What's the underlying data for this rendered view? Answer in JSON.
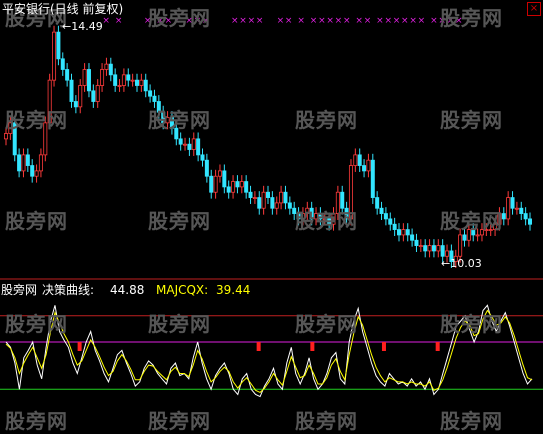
{
  "window": {
    "title": "平安银行(日线 前复权)",
    "close_glyph": "×"
  },
  "watermark": "股旁网",
  "price_panel": {
    "high_label": "14.49",
    "low_label": "10.03",
    "marker_glyph": "×",
    "colors": {
      "up": "#ff3b3b",
      "down": "#33e5ff",
      "marker": "#e020e0"
    }
  },
  "indicator_panel": {
    "name": "股旁网",
    "line1_label": "决策曲线:",
    "line1_value": "44.88",
    "line2_label": "MAJCQX:",
    "line2_value": "39.44",
    "colors": {
      "line1": "#ffffff",
      "line2": "#ffff00",
      "top_line": "#c02020",
      "mid_line": "#e020e0",
      "bottom_line": "#20d020",
      "signal": "#ff2020"
    }
  },
  "chart_data": {
    "type": "candlestick",
    "price_ylim": [
      10.03,
      14.49
    ],
    "candles_close": [
      12.4,
      12.6,
      12.0,
      11.7,
      12.0,
      11.8,
      11.6,
      11.7,
      12.0,
      12.6,
      13.4,
      14.3,
      13.8,
      13.6,
      13.4,
      13.0,
      12.9,
      13.3,
      13.6,
      13.2,
      13.0,
      13.3,
      13.6,
      13.7,
      13.5,
      13.3,
      13.3,
      13.5,
      13.4,
      13.4,
      13.3,
      13.4,
      13.2,
      13.1,
      13.0,
      12.8,
      12.6,
      12.7,
      12.5,
      12.3,
      12.2,
      12.2,
      12.1,
      12.3,
      12.0,
      11.9,
      11.6,
      11.3,
      11.6,
      11.7,
      11.4,
      11.3,
      11.5,
      11.4,
      11.5,
      11.3,
      11.2,
      11.2,
      11.0,
      11.3,
      11.2,
      11.0,
      11.1,
      11.3,
      11.1,
      11.0,
      10.9,
      10.8,
      10.9,
      11.0,
      10.8,
      10.9,
      10.8,
      10.8,
      10.7,
      10.9,
      11.3,
      11.0,
      10.8,
      11.8,
      12.0,
      11.8,
      11.7,
      11.9,
      11.2,
      11.0,
      10.9,
      10.8,
      10.7,
      10.6,
      10.5,
      10.6,
      10.5,
      10.4,
      10.3,
      10.3,
      10.2,
      10.3,
      10.2,
      10.3,
      10.1,
      10.2,
      10.0,
      10.1,
      10.5,
      10.4,
      10.6,
      10.5,
      10.5,
      10.6,
      10.6,
      10.6,
      10.7,
      10.9,
      10.8,
      11.2,
      11.0,
      11.0,
      10.9,
      10.8,
      10.7
    ],
    "indicator_ylim": [
      0,
      100
    ],
    "reference_lines": [
      85,
      60,
      15
    ],
    "series": [
      {
        "name": "决策曲线",
        "values": [
          60,
          55,
          40,
          15,
          45,
          52,
          60,
          38,
          25,
          55,
          80,
          95,
          70,
          62,
          55,
          40,
          30,
          45,
          60,
          70,
          52,
          42,
          30,
          22,
          35,
          48,
          52,
          40,
          30,
          18,
          22,
          35,
          42,
          38,
          30,
          25,
          20,
          35,
          40,
          28,
          30,
          25,
          45,
          60,
          40,
          25,
          15,
          28,
          35,
          40,
          30,
          15,
          10,
          25,
          30,
          15,
          10,
          8,
          18,
          25,
          35,
          20,
          15,
          40,
          55,
          30,
          20,
          30,
          45,
          25,
          15,
          20,
          30,
          45,
          50,
          25,
          20,
          60,
          80,
          92,
          70,
          55,
          40,
          28,
          22,
          18,
          30,
          25,
          20,
          22,
          18,
          25,
          18,
          22,
          15,
          25,
          10,
          15,
          30,
          45,
          60,
          75,
          80,
          85,
          72,
          60,
          70,
          90,
          95,
          80,
          70,
          80,
          88,
          75,
          60,
          45,
          30,
          20,
          25
        ]
      },
      {
        "name": "MAJCQX",
        "values": [
          58,
          54,
          45,
          30,
          40,
          48,
          55,
          45,
          35,
          48,
          70,
          88,
          78,
          68,
          60,
          48,
          38,
          42,
          52,
          62,
          55,
          46,
          36,
          28,
          32,
          42,
          48,
          42,
          34,
          24,
          24,
          32,
          38,
          37,
          32,
          28,
          24,
          32,
          36,
          30,
          30,
          27,
          38,
          52,
          44,
          32,
          22,
          26,
          32,
          36,
          32,
          22,
          16,
          22,
          26,
          20,
          14,
          12,
          16,
          22,
          30,
          24,
          19,
          32,
          46,
          36,
          26,
          28,
          38,
          30,
          20,
          20,
          26,
          38,
          44,
          32,
          24,
          48,
          68,
          84,
          76,
          62,
          48,
          36,
          28,
          22,
          26,
          24,
          22,
          22,
          20,
          22,
          20,
          20,
          18,
          22,
          14,
          16,
          24,
          36,
          50,
          64,
          74,
          80,
          76,
          66,
          68,
          82,
          90,
          84,
          76,
          78,
          84,
          78,
          66,
          52,
          38,
          26,
          24
        ]
      }
    ],
    "signals_at": [
      4,
      14,
      17,
      21,
      24,
      50,
      76,
      106,
      109
    ]
  }
}
